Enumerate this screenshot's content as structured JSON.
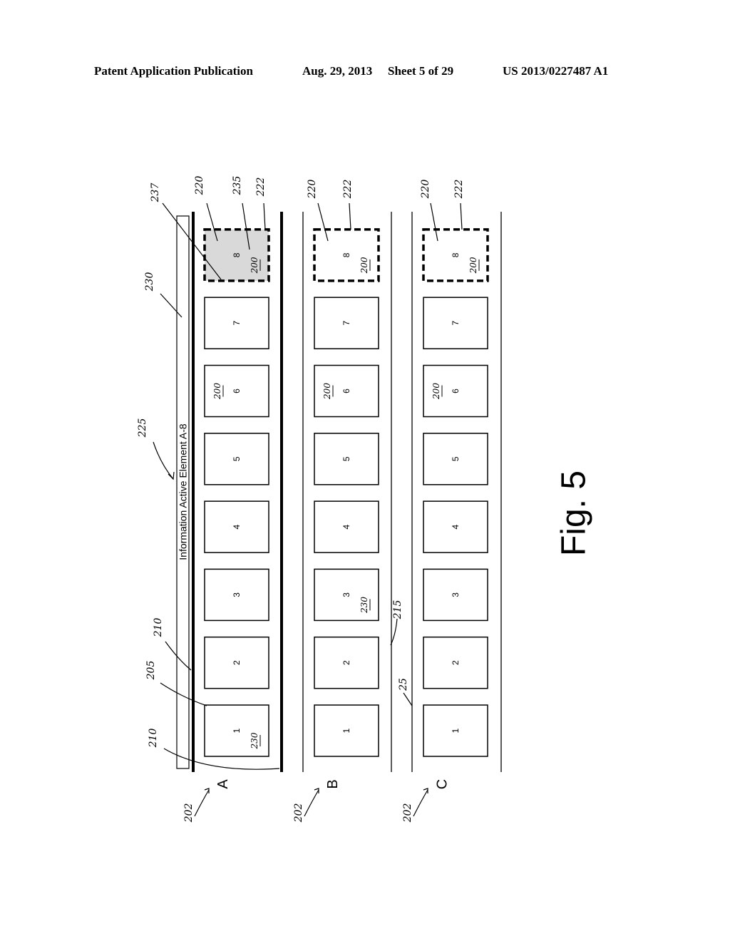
{
  "header": {
    "publication": "Patent Application Publication",
    "date": "Aug. 29, 2013",
    "sheet": "Sheet 5 of 29",
    "number": "US 2013/0227487 A1"
  },
  "figure": {
    "caption": "Fig. 5",
    "info_bar_text": "Information Active Element A-8",
    "rows": [
      {
        "label": "A",
        "ref": "202",
        "highlighted_element": "8",
        "elements": [
          "1",
          "2",
          "3",
          "4",
          "5",
          "6",
          "7",
          "8"
        ],
        "element_refs": {
          "1": "230",
          "6": "200",
          "8": "200"
        },
        "styles": {
          "border": "thick",
          "active_fill": "#d9d9d9"
        }
      },
      {
        "label": "B",
        "ref": "202",
        "highlighted_element": "8",
        "elements": [
          "1",
          "2",
          "3",
          "4",
          "5",
          "6",
          "7",
          "8"
        ],
        "element_refs": {
          "3": "230",
          "6": "200",
          "8": "200"
        },
        "styles": {
          "border": "thin",
          "active_fill": "#ffffff"
        }
      },
      {
        "label": "C",
        "ref": "202",
        "highlighted_element": "8",
        "elements": [
          "1",
          "2",
          "3",
          "4",
          "5",
          "6",
          "7",
          "8"
        ],
        "element_refs": {
          "6": "200",
          "8": "200"
        },
        "styles": {
          "border": "thin",
          "active_fill": "#ffffff"
        }
      }
    ],
    "reference_numerals": {
      "info_display": "225",
      "info_bar": "230",
      "active_area": "237",
      "highlight_region": "235",
      "selected_element": "220",
      "dashed_border": "222",
      "row_spacing": "205",
      "row_border": "210",
      "row_boundary": "215",
      "row_gap": "25"
    }
  }
}
